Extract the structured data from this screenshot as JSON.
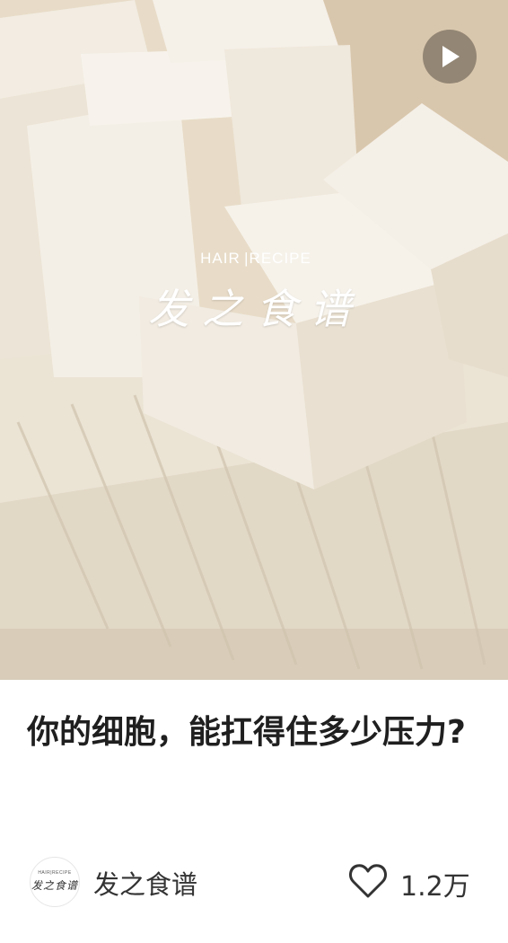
{
  "media": {
    "logo_en": "HAIR |RECIPE",
    "logo_cn": "发之食谱",
    "play_icon": "play-icon"
  },
  "post": {
    "title": "你的细胞，能扛得住多少压力?"
  },
  "author": {
    "name": "发之食谱",
    "avatar_en": "HAIR|RECIPE",
    "avatar_cn": "发之食谱"
  },
  "likes": {
    "icon": "heart-outline-icon",
    "count": "1.2万"
  }
}
